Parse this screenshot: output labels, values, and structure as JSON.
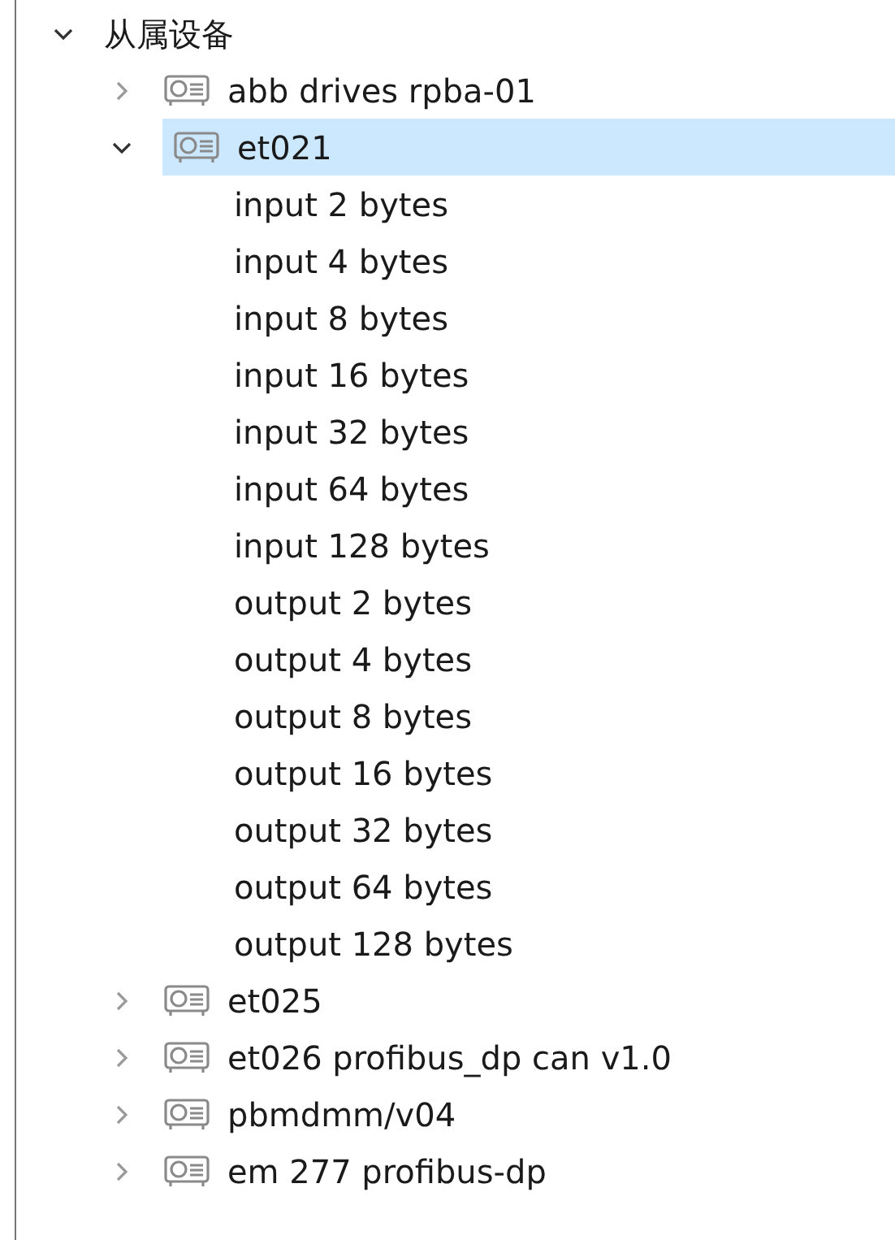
{
  "tree": [
    {
      "label": "从属设备",
      "kind": "folder",
      "expanded": true,
      "selected": false,
      "children": [
        {
          "label": "abb drives rpba-01",
          "kind": "device",
          "expanded": false,
          "selected": false
        },
        {
          "label": "et021",
          "kind": "device",
          "expanded": true,
          "selected": true,
          "children": [
            {
              "label": "input 2 bytes",
              "selected": false
            },
            {
              "label": "input 4 bytes",
              "selected": false
            },
            {
              "label": "input 8 bytes",
              "selected": false
            },
            {
              "label": "input 16 bytes",
              "selected": false
            },
            {
              "label": "input 32 bytes",
              "selected": false
            },
            {
              "label": "input 64 bytes",
              "selected": false
            },
            {
              "label": "input 128 bytes",
              "selected": false
            },
            {
              "label": "output 2 bytes",
              "selected": false
            },
            {
              "label": "output 4 bytes",
              "selected": false
            },
            {
              "label": "output 8 bytes",
              "selected": false
            },
            {
              "label": "output 16 bytes",
              "selected": false
            },
            {
              "label": "output 32 bytes",
              "selected": false
            },
            {
              "label": "output 64 bytes",
              "selected": false
            },
            {
              "label": "output 128 bytes",
              "selected": false
            }
          ]
        },
        {
          "label": "et025",
          "kind": "device",
          "expanded": false,
          "selected": false
        },
        {
          "label": "et026 profibus_dp can v1.0",
          "kind": "device",
          "expanded": false,
          "selected": false
        },
        {
          "label": "pbmdmm/v04",
          "kind": "device",
          "expanded": false,
          "selected": false
        },
        {
          "label": "em 277 profibus-dp",
          "kind": "device",
          "expanded": false,
          "selected": false
        }
      ]
    }
  ]
}
